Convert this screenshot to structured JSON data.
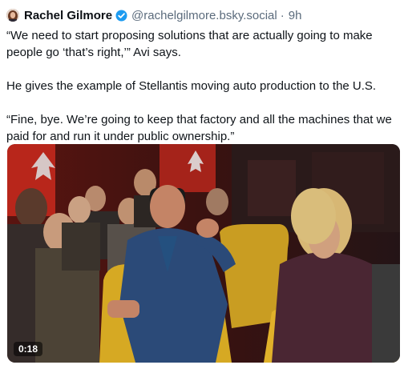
{
  "post": {
    "author_name": "Rachel Gilmore",
    "handle": "@rachelgilmore.bsky.social",
    "separator": "·",
    "time_ago": "9h",
    "paragraphs": [
      "“We need to start proposing solutions that are actually going to make people go ‘that’s right,’” Avi says.",
      "He gives the example of Stellantis moving auto production to the U.S.",
      "“Fine, bye. We’re going to keep that factory and all the machines that we paid for and run it under public ownership.”"
    ]
  },
  "video": {
    "duration": "0:18"
  },
  "icons": {
    "verified": "verified-check-icon"
  },
  "colors": {
    "verified_badge": "#1d9bf0",
    "handle_text": "#5b6b7c"
  }
}
